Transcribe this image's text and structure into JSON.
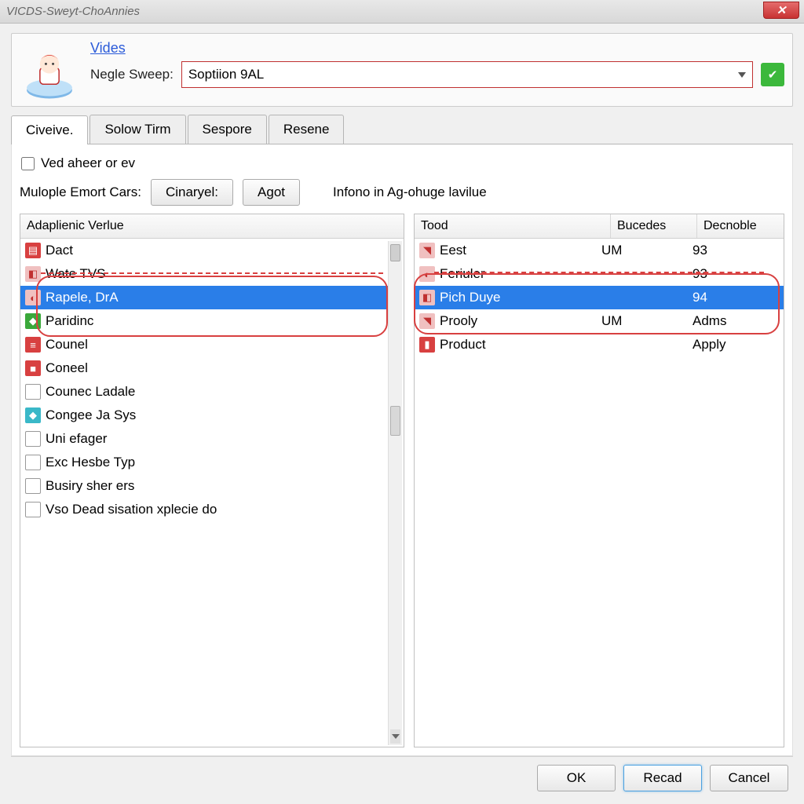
{
  "titlebar": {
    "title": "VICDS-Sweyt-ChoAnnies"
  },
  "top": {
    "link": "Vides",
    "field_label": "Negle Sweep:",
    "combo_value": "Soptiion 9AL"
  },
  "tabs": [
    "Civeive.",
    "Solow Tirm",
    "Sespore",
    "Resene"
  ],
  "active_tab": 0,
  "checkbox": {
    "label": "Ved aheer or ev",
    "checked": false
  },
  "button_row": {
    "label": "Mulople Emort Cars:",
    "btn1": "Cinaryel:",
    "btn2": "Agot",
    "info": "Infono in Ag-ohuge lavilue"
  },
  "left": {
    "header": "Adaplienic Verlue",
    "items": [
      {
        "label": "Dact",
        "icon": "icon-red",
        "glyph": "▤",
        "selected": false
      },
      {
        "label": "Wate TVS",
        "icon": "icon-pinkish",
        "glyph": "◧",
        "selected": false
      },
      {
        "label": "Rapele, DrA",
        "icon": "icon-pinkish",
        "glyph": "◐",
        "selected": true
      },
      {
        "label": "Paridinc",
        "icon": "icon-green",
        "glyph": "◆",
        "selected": false
      },
      {
        "label": "Counel",
        "icon": "icon-red",
        "glyph": "≡",
        "selected": false
      },
      {
        "label": "Coneel",
        "icon": "icon-red",
        "glyph": "■",
        "selected": false
      },
      {
        "label": "Counec Ladale",
        "icon": "icon-box",
        "glyph": "",
        "selected": false
      },
      {
        "label": "Congee Ja Sys",
        "icon": "icon-teal",
        "glyph": "◆",
        "selected": false
      },
      {
        "label": "Uni efager",
        "icon": "icon-box",
        "glyph": "",
        "selected": false
      },
      {
        "label": "Exc Hesbe Typ",
        "icon": "icon-box",
        "glyph": "",
        "selected": false
      },
      {
        "label": "Busiry sher ers",
        "icon": "icon-box",
        "glyph": "",
        "selected": false
      },
      {
        "label": "Vso Dead sisation xplecie do",
        "icon": "icon-box",
        "glyph": "",
        "selected": false
      }
    ]
  },
  "right": {
    "headers": {
      "tood": "Tood",
      "bucedes": "Bucedes",
      "decnoble": "Decnoble"
    },
    "items": [
      {
        "tood": "Eest",
        "bucedes": "UM",
        "decnoble": "93",
        "icon": "icon-pinkish",
        "glyph": "◥",
        "selected": false
      },
      {
        "tood": "Feriuler",
        "bucedes": "",
        "decnoble": "93",
        "icon": "icon-pinkish",
        "glyph": "◐",
        "selected": false
      },
      {
        "tood": "Pich Duye",
        "bucedes": "",
        "decnoble": "94",
        "icon": "icon-pinkish",
        "glyph": "◧",
        "selected": true
      },
      {
        "tood": "Prooly",
        "bucedes": "UM",
        "decnoble": "Adms",
        "icon": "icon-pinkish",
        "glyph": "◥",
        "selected": false
      },
      {
        "tood": "Product",
        "bucedes": "",
        "decnoble": "Apply",
        "icon": "icon-red",
        "glyph": "▮",
        "selected": false
      }
    ]
  },
  "bottom": {
    "ok": "OK",
    "recad": "Recad",
    "cancel": "Cancel"
  }
}
